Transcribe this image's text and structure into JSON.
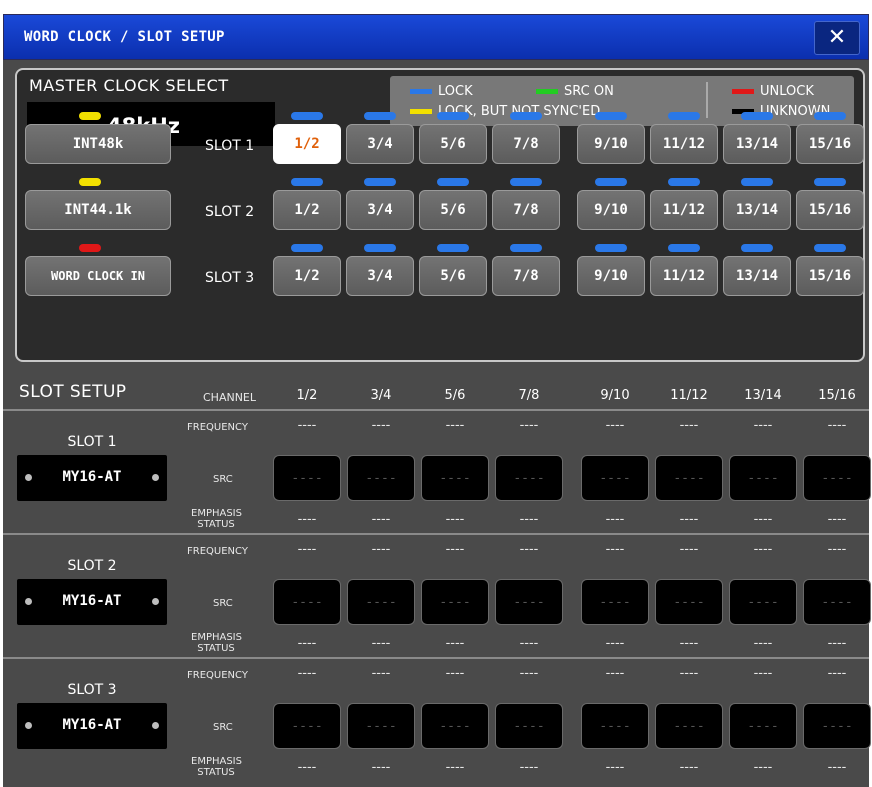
{
  "window": {
    "title": "WORD CLOCK / SLOT SETUP",
    "close_glyph": "✕"
  },
  "master_clock": {
    "title": "MASTER CLOCK SELECT",
    "frequency": "48kHz",
    "legend": [
      {
        "label": "LOCK",
        "color": "#2a78e8"
      },
      {
        "label": "SRC ON",
        "color": "#22cc22"
      },
      {
        "label": "LOCK,  BUT NOT SYNC'ED",
        "color": "#f2e000"
      },
      {
        "label": "UNLOCK",
        "color": "#e01818"
      },
      {
        "label": "UNKNOWN",
        "color": "#000000"
      }
    ],
    "sources": [
      {
        "label": "INT48k",
        "indicator": "#f2e000"
      },
      {
        "label": "INT44.1k",
        "indicator": "#f2e000"
      },
      {
        "label": "WORD CLOCK IN",
        "indicator": "#e01818"
      }
    ],
    "slots": [
      {
        "label": "SLOT 1",
        "selected": "1/2"
      },
      {
        "label": "SLOT 2",
        "selected": ""
      },
      {
        "label": "SLOT 3",
        "selected": ""
      }
    ],
    "channel_pairs": [
      "1/2",
      "3/4",
      "5/6",
      "7/8",
      "9/10",
      "11/12",
      "13/14",
      "15/16"
    ],
    "channel_indicator_color": "#2a78e8"
  },
  "slot_setup": {
    "title": "SLOT SETUP",
    "channel_label": "CHANNEL",
    "frequency_label": "FREQUENCY",
    "src_label": "SRC",
    "emphasis_label_1": "EMPHASIS",
    "emphasis_label_2": "STATUS",
    "channels": [
      "1/2",
      "3/4",
      "5/6",
      "7/8",
      "9/10",
      "11/12",
      "13/14",
      "15/16"
    ],
    "empty_value": "----",
    "slots": [
      {
        "name": "SLOT 1",
        "card": "MY16-AT"
      },
      {
        "name": "SLOT 2",
        "card": "MY16-AT"
      },
      {
        "name": "SLOT 3",
        "card": "MY16-AT"
      }
    ]
  }
}
